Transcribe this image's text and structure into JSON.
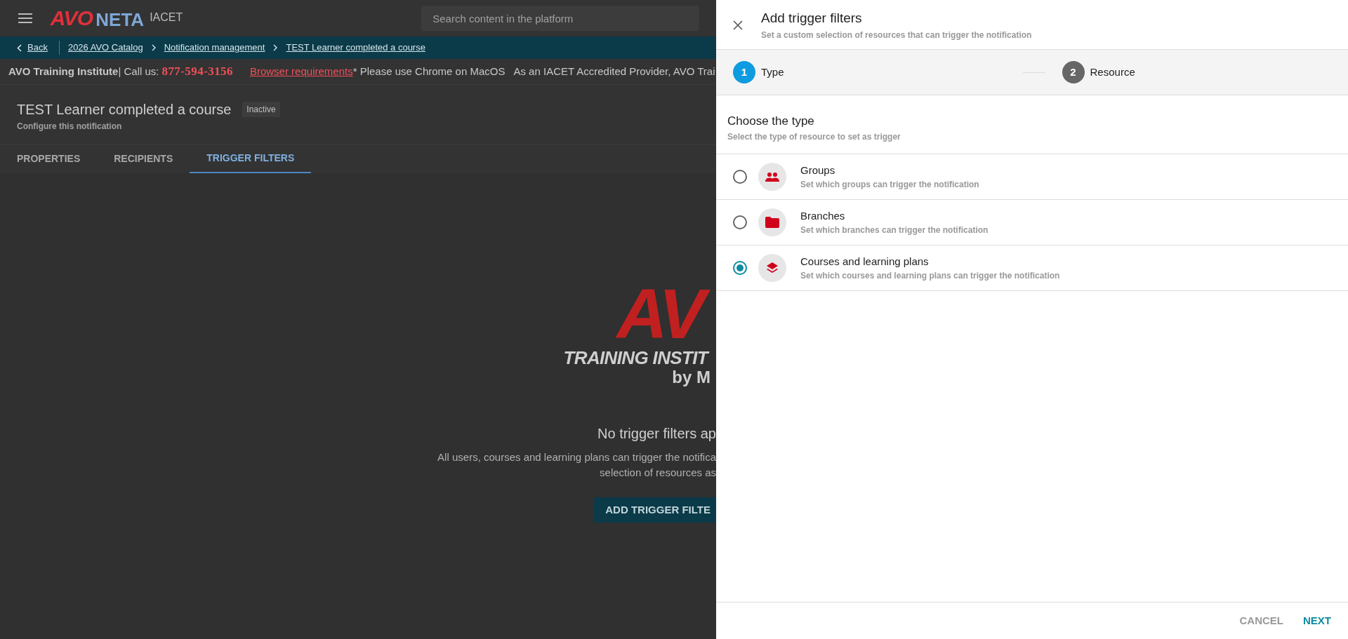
{
  "header": {
    "logo": {
      "red_part": "AVO",
      "dark_part": "NETA",
      "badge": "IACET"
    },
    "search": {
      "placeholder": "Search content in the platform"
    }
  },
  "breadcrumbs": [
    {
      "label": "Back",
      "kind": "back"
    },
    {
      "label": "2026 AVO Catalog",
      "kind": "crumb"
    },
    {
      "label": "Notification management",
      "kind": "crumb"
    },
    {
      "label": "TEST Learner completed a course",
      "kind": "crumb"
    }
  ],
  "info_bar": {
    "org": "AVO Training Institute",
    "call_label": "| Call us: ",
    "phone": "877-594-3156",
    "link": "Browser requirements",
    "note": "* Please use Chrome on MacOS",
    "accreditation": "As an IACET Accredited Provider, AVO Trai"
  },
  "page": {
    "title": "TEST Learner completed a course",
    "status": "Inactive",
    "subtitle": "Configure this notification"
  },
  "tabs": [
    {
      "label": "PROPERTIES",
      "selected": false
    },
    {
      "label": "RECIPIENTS",
      "selected": false
    },
    {
      "label": "TRIGGER FILTERS",
      "selected": true
    }
  ],
  "empty_state": {
    "logo_mark": "AV",
    "logo_line": "TRAINING INSTIT",
    "logo_by": "by M",
    "heading": "No trigger filters ap",
    "description": [
      "All users, courses and learning plans can trigger the notifica",
      "selection of resources as"
    ],
    "button": "ADD TRIGGER FILTE"
  },
  "panel": {
    "title": "Add trigger filters",
    "subtitle": "Set a custom selection of resources that can trigger the notification",
    "steps": [
      {
        "number": "1",
        "label": "Type",
        "selected": true
      },
      {
        "number": "2",
        "label": "Resource",
        "selected": false
      }
    ],
    "section_title": "Choose the type",
    "section_subtitle": "Select the type of resource to set as trigger",
    "options": [
      {
        "kind": "groups",
        "title": "Groups",
        "description": "Set which groups can trigger the notification",
        "selected": false
      },
      {
        "kind": "branches",
        "title": "Branches",
        "description": "Set which branches can trigger the notification",
        "selected": false
      },
      {
        "kind": "courses",
        "title": "Courses and learning plans",
        "description": "Set which courses and learning plans can trigger the notification",
        "selected": true
      }
    ],
    "buttons": {
      "cancel": "CANCEL",
      "next": "NEXT"
    }
  }
}
